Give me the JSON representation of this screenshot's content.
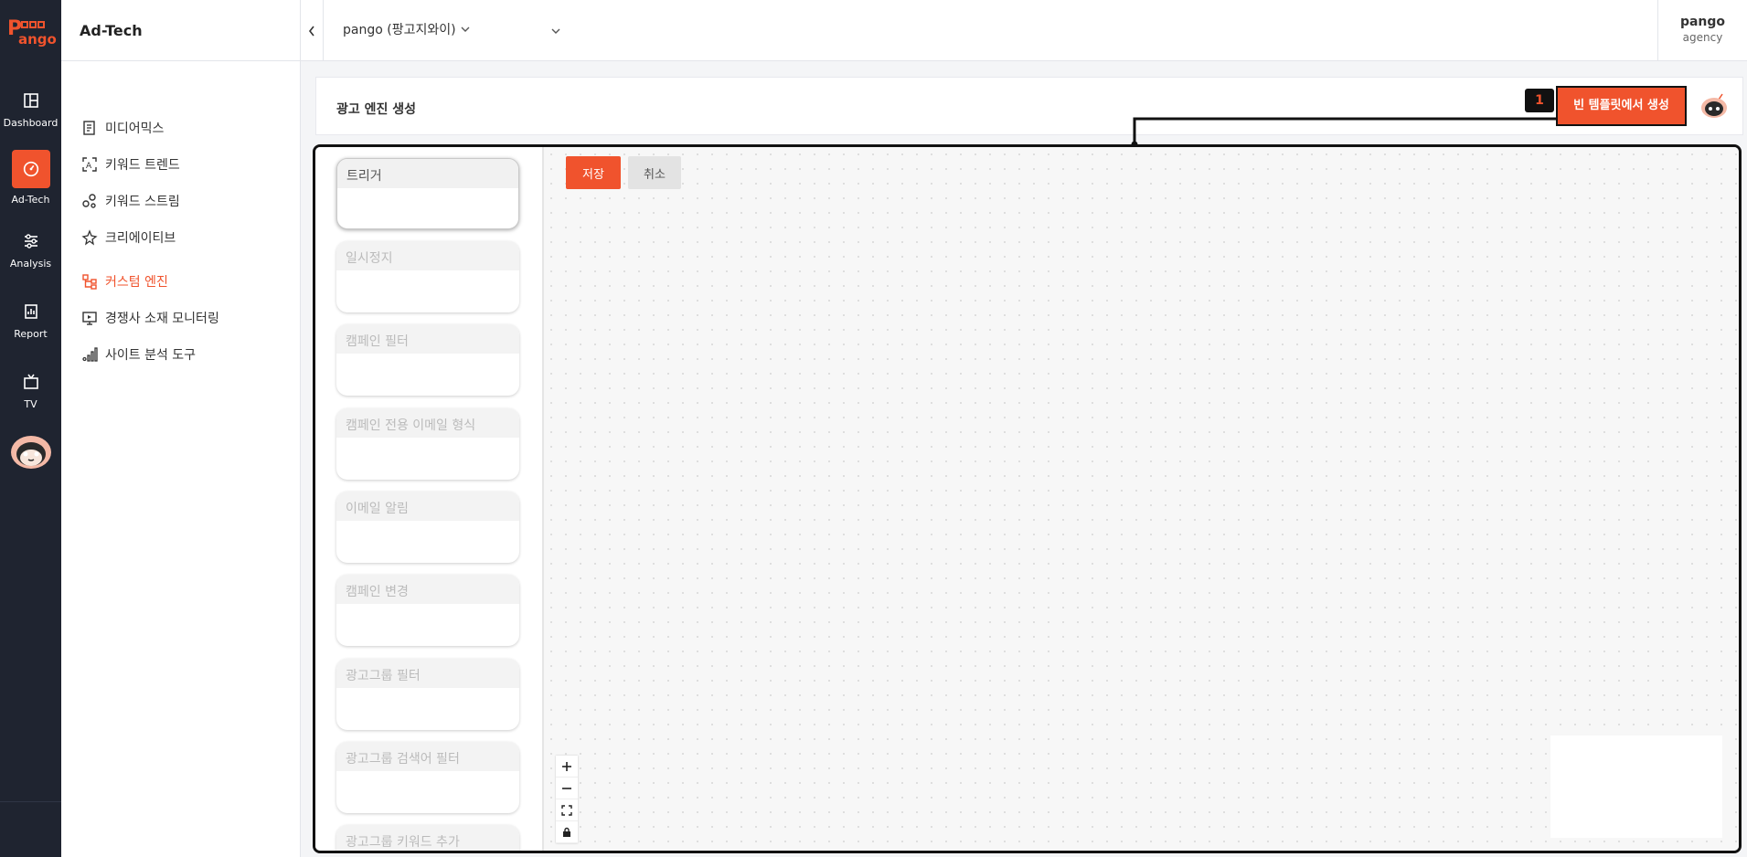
{
  "brand": {
    "accent": "#f0532d",
    "rail_bg": "#1f2430"
  },
  "rail": {
    "items": [
      {
        "label": "Dashboard",
        "icon": "dashboard-icon"
      },
      {
        "label": "Ad-Tech",
        "icon": "gauge-icon",
        "active": true
      },
      {
        "label": "Analysis",
        "icon": "sliders-icon"
      },
      {
        "label": "Report",
        "icon": "report-icon"
      },
      {
        "label": "TV",
        "icon": "tv-icon"
      }
    ]
  },
  "sidebar": {
    "title": "Ad-Tech",
    "items": [
      {
        "label": "미디어믹스",
        "icon": "document-icon"
      },
      {
        "label": "키워드 트렌드",
        "icon": "scan-text-icon"
      },
      {
        "label": "키워드 스트림",
        "icon": "nodes-icon"
      },
      {
        "label": "크리에이티브",
        "icon": "sparkle-icon"
      },
      {
        "label": "커스텀 엔진",
        "icon": "flow-icon",
        "active": true
      },
      {
        "label": "경쟁사 소재 모니터링",
        "icon": "monitor-icon"
      },
      {
        "label": "사이트 분석 도구",
        "icon": "bar-chart-icon"
      }
    ]
  },
  "topbar": {
    "account": "pango (팡고지와이)",
    "user_name": "pango",
    "user_role": "agency"
  },
  "page": {
    "title": "광고 엔진 생성",
    "badge": "1",
    "template_button": "빈 템플릿에서 생성"
  },
  "palette": {
    "nodes": [
      "트리거",
      "일시정지",
      "캠페인 필터",
      "캠페인 전용 이메일 형식",
      "이메일 알림",
      "캠페인 변경",
      "광고그룹 필터",
      "광고그룹 검색어 필터",
      "광고그룹 키워드 추가"
    ]
  },
  "canvas": {
    "save_label": "저장",
    "cancel_label": "취소",
    "controls": [
      "+",
      "−"
    ]
  }
}
